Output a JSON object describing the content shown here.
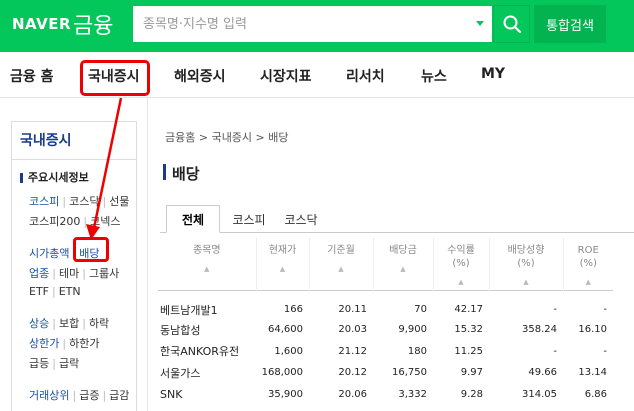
{
  "header": {
    "logo_naver": "NAVER",
    "logo_finance": "금융",
    "search_placeholder": "종목명·지수명 입력",
    "total_search_label": "통합검색",
    "accent_color": "#03c75a"
  },
  "nav": {
    "items": [
      "금융 홈",
      "국내증시",
      "해외증시",
      "시장지표",
      "리서치",
      "뉴스",
      "MY"
    ],
    "active": "국내증시"
  },
  "sidebar": {
    "title": "국내증시",
    "section": "주요시세정보",
    "rows": [
      [
        "코스피",
        "코스닥",
        "선물"
      ],
      [
        "코스피200",
        "코넥스"
      ],
      [
        "시가총액",
        "배당"
      ],
      [
        "업종",
        "테마",
        "그룹사"
      ],
      [
        "ETF",
        "ETN"
      ],
      [
        "상승",
        "보합",
        "하락"
      ],
      [
        "상한가",
        "하한가"
      ],
      [
        "급등",
        "급락"
      ],
      [
        "거래상위",
        "급증",
        "급감"
      ]
    ]
  },
  "main": {
    "breadcrumb": "금융홈 > 국내증시 > 배당",
    "title": "배당",
    "tabs": [
      "전체",
      "코스피",
      "코스닥"
    ],
    "columns": [
      "종목명",
      "현재가",
      "기준월",
      "배당금",
      "수익률\n(%)",
      "배당성향\n(%)",
      "ROE\n(%)"
    ],
    "rows": [
      [
        "베트남개발1",
        "166",
        "20.11",
        "70",
        "42.17",
        "-",
        "-"
      ],
      [
        "동남합성",
        "64,600",
        "20.03",
        "9,900",
        "15.32",
        "358.24",
        "16.10"
      ],
      [
        "한국ANKOR유전",
        "1,600",
        "21.12",
        "180",
        "11.25",
        "-",
        "-"
      ],
      [
        "서울가스",
        "168,000",
        "20.12",
        "16,750",
        "9.97",
        "49.66",
        "13.14"
      ],
      [
        "SNK",
        "35,900",
        "20.06",
        "3,332",
        "9.28",
        "314.05",
        "6.86"
      ]
    ]
  }
}
